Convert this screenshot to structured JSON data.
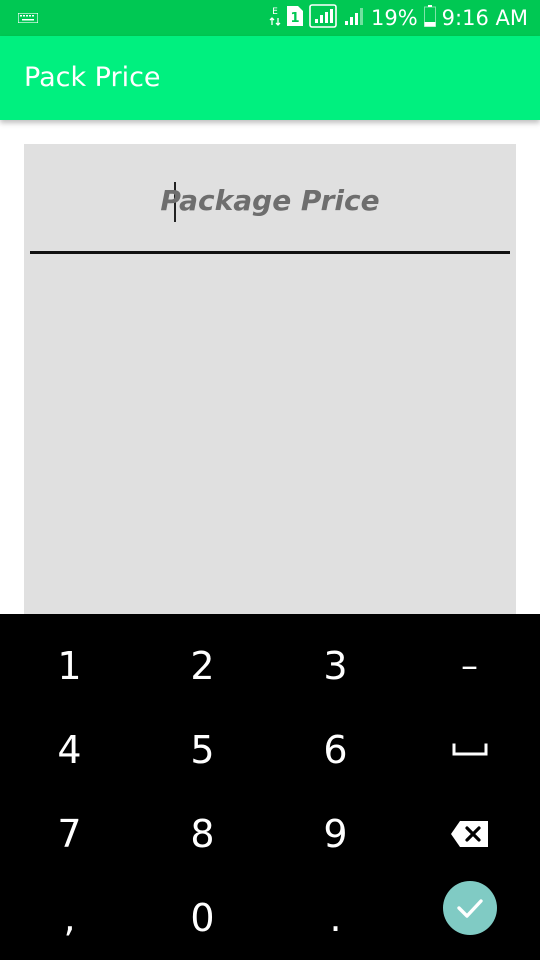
{
  "status_bar": {
    "battery": "19%",
    "time": "9:16 AM",
    "sim": "1",
    "network": "E",
    "icons": [
      "keyboard-icon",
      "data-arrows-icon",
      "sim-icon",
      "signal-icon",
      "signal-icon",
      "battery-icon"
    ]
  },
  "app_bar": {
    "title": "Pack Price",
    "color": "#00f07f"
  },
  "form": {
    "price_field": {
      "placeholder": "Package Price",
      "value": ""
    }
  },
  "keyboard": {
    "rows": [
      [
        "1",
        "2",
        "3",
        "–"
      ],
      [
        "4",
        "5",
        "6",
        "space-icon"
      ],
      [
        "7",
        "8",
        "9",
        "backspace-icon"
      ],
      [
        ",",
        "0",
        ".",
        "done-check-icon"
      ]
    ],
    "done_color": "#80cbc4"
  }
}
